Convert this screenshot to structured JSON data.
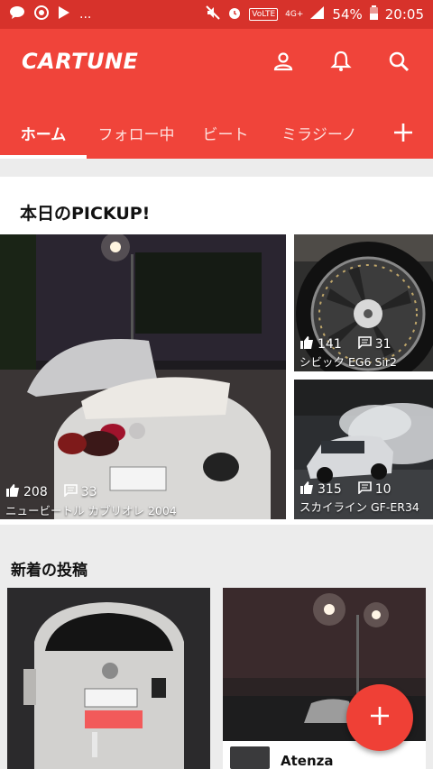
{
  "status_bar": {
    "left_icons": [
      "chat-bubble-icon",
      "circular-app-icon",
      "play-store-icon"
    ],
    "ellipsis": "...",
    "volte": "VoLTE",
    "network": "4G+",
    "battery": "54%",
    "time": "20:05"
  },
  "header": {
    "logo": "CARTUNE",
    "actions": [
      "profile-icon",
      "bell-icon",
      "search-icon"
    ]
  },
  "tabs": [
    {
      "label": "ホーム",
      "active": true
    },
    {
      "label": "フォロー中",
      "active": false
    },
    {
      "label": "ビート",
      "active": false
    },
    {
      "label": "ミラジーノ",
      "active": false
    }
  ],
  "pickup": {
    "title": "本日のPICKUP!",
    "cards": [
      {
        "likes": "208",
        "comments": "33",
        "caption": "ニュービートル カブリオレ 2004"
      },
      {
        "likes": "141",
        "comments": "31",
        "caption": "シビック EG6 Sir2"
      },
      {
        "likes": "315",
        "comments": "10",
        "caption": "スカイライン GF-ER34"
      }
    ]
  },
  "new_posts": {
    "title": "新着の投稿",
    "posts": [
      {
        "car_name": ""
      },
      {
        "car_name": "Atenza"
      }
    ]
  },
  "fab": {
    "icon": "plus-icon"
  },
  "colors": {
    "statusbar": "#d7322b",
    "appbar": "#f0443a",
    "fab": "#ef4036"
  }
}
